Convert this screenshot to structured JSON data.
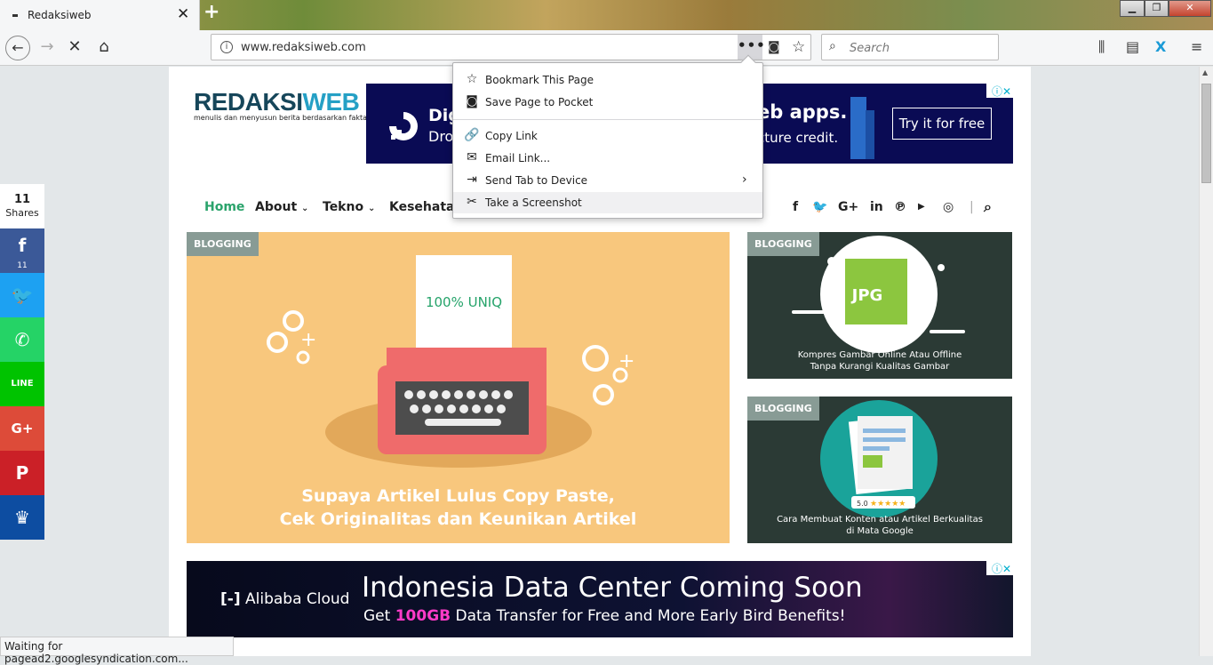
{
  "browser": {
    "tab_title": "Redaksiweb",
    "url": "www.redaksiweb.com",
    "search_placeholder": "Search",
    "status_text": "Waiting for pagead2.googlesyndication.com..."
  },
  "page_actions_menu": {
    "items": [
      {
        "label": "Bookmark This Page",
        "icon": "star-icon"
      },
      {
        "label": "Save Page to Pocket",
        "icon": "pocket-icon"
      },
      {
        "label": "Copy Link",
        "icon": "link-icon"
      },
      {
        "label": "Email Link...",
        "icon": "envelope-icon"
      },
      {
        "label": "Send Tab to Device",
        "icon": "send-device-icon"
      },
      {
        "label": "Take a Screenshot",
        "icon": "scissors-icon"
      }
    ]
  },
  "site": {
    "logo_main_dark": "REDAKSI",
    "logo_main_light": "WEB",
    "logo_tagline": "menulis dan menyusun berita berdasarkan fakta",
    "nav": [
      "Home",
      "About",
      "Tekno",
      "Kesehatan"
    ],
    "nav_active_color": "#2aa36b"
  },
  "ads": {
    "top_headline_left": "Dig",
    "top_headline_left2": "Dro",
    "top_headline_right": "eb apps.",
    "top_sub_right": "cture credit.",
    "top_cta": "Try it for free",
    "bottom_brand": "Alibaba Cloud",
    "bottom_headline": "Indonesia Data Center Coming Soon",
    "bottom_sub_pre": "Get ",
    "bottom_sub_highlight": "100GB",
    "bottom_sub_post": " Data Transfer for Free and More Early Bird Benefits!"
  },
  "posts": [
    {
      "badge": "BLOGGING",
      "image_text": "100% UNIQ",
      "caption_line1": "Supaya Artikel Lulus Copy Paste,",
      "caption_line2": "Cek Originalitas dan Keunikan Artikel"
    },
    {
      "badge": "BLOGGING",
      "image_text": "JPG",
      "caption_line1": "Kompres Gambar Online Atau Offline",
      "caption_line2": "Tanpa Kurangi Kualitas Gambar"
    },
    {
      "badge": "BLOGGING",
      "image_text": "5.0",
      "caption_line1": "Cara Membuat Konten atau Artikel Berkualitas",
      "caption_line2": "di Mata Google"
    }
  ],
  "share_bar": {
    "count": "11",
    "count_label": "Shares",
    "facebook_count": "11",
    "colors": [
      "#3b5998",
      "#1da1f2",
      "#25d366",
      "#00c300",
      "#dd4b39",
      "#cb2027",
      "#0d4da1"
    ]
  }
}
